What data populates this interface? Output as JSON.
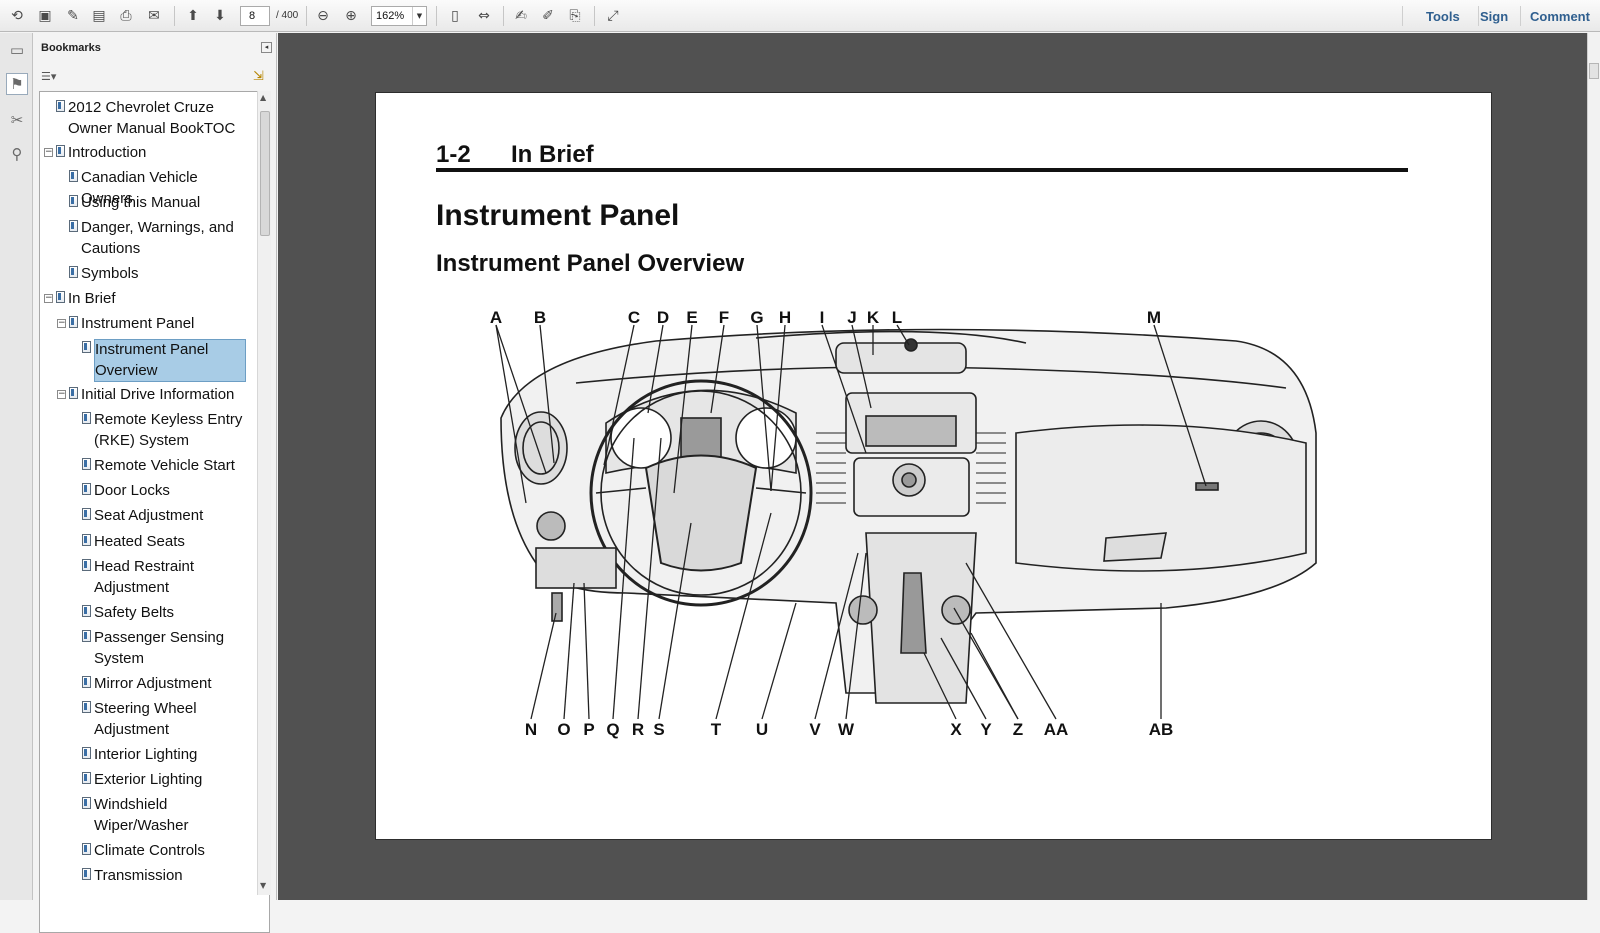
{
  "toolbar": {
    "page_current": "8",
    "page_total": "/ 400",
    "zoom": "162%",
    "right_links": [
      "Tools",
      "Sign",
      "Comment"
    ]
  },
  "bookmarks": {
    "title": "Bookmarks",
    "items": [
      {
        "label": "2012 Chevrolet Cruze Owner Manual BookTOC"
      },
      {
        "label": "Introduction"
      },
      {
        "label": "Canadian Vehicle Owners"
      },
      {
        "label": "Using this Manual"
      },
      {
        "label": "Danger, Warnings, and Cautions"
      },
      {
        "label": "Symbols"
      },
      {
        "label": "In Brief"
      },
      {
        "label": "Instrument Panel"
      },
      {
        "label": "Instrument Panel Overview"
      },
      {
        "label": "Initial Drive Information"
      },
      {
        "label": "Remote Keyless Entry (RKE) System"
      },
      {
        "label": "Remote Vehicle Start"
      },
      {
        "label": "Door Locks"
      },
      {
        "label": "Seat Adjustment"
      },
      {
        "label": "Heated Seats"
      },
      {
        "label": "Head Restraint Adjustment"
      },
      {
        "label": "Safety Belts"
      },
      {
        "label": "Passenger Sensing System"
      },
      {
        "label": "Mirror Adjustment"
      },
      {
        "label": "Steering Wheel Adjustment"
      },
      {
        "label": "Interior Lighting"
      },
      {
        "label": "Exterior Lighting"
      },
      {
        "label": "Windshield Wiper/Washer"
      },
      {
        "label": "Climate Controls"
      },
      {
        "label": "Transmission"
      }
    ]
  },
  "page": {
    "section_number": "1-2",
    "section_title": "In Brief",
    "heading": "Instrument Panel",
    "subheading": "Instrument Panel Overview",
    "callouts_top": [
      "A",
      "B",
      "C",
      "D",
      "E",
      "F",
      "G",
      "H",
      "I",
      "J",
      "K",
      "L",
      "M"
    ],
    "callouts_bottom": [
      "N",
      "O",
      "P",
      "Q",
      "R",
      "S",
      "T",
      "U",
      "V",
      "W",
      "X",
      "Y",
      "Z",
      "AA",
      "AB"
    ]
  }
}
